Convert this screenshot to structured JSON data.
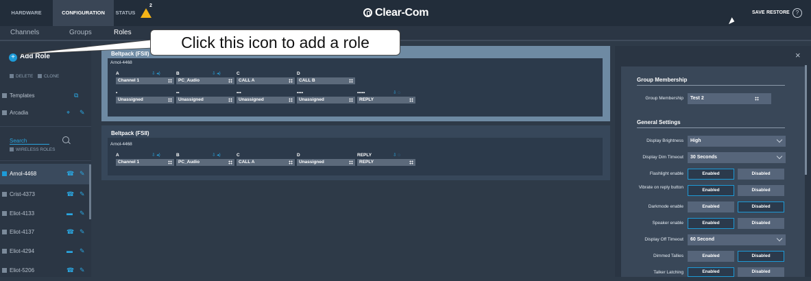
{
  "topbar": {
    "tabs": [
      "HARDWARE",
      "CONFIGURATION",
      "STATUS"
    ],
    "status_count": "2",
    "brand": "Clear-Com",
    "save_label": "SAVE",
    "restore_label": "RESTORE",
    "help_glyph": "?"
  },
  "subnav": {
    "tabs": [
      "Channels",
      "Groups",
      "Roles"
    ]
  },
  "callout": {
    "text": "Click this icon to add a role"
  },
  "sidebar": {
    "add_role": "Add Role",
    "delete": "DELETE",
    "clone": "CLONE",
    "templates": "Templates",
    "arcadia": "Arcadia",
    "search": "Search",
    "wireless_roles": "WIRELESS ROLES",
    "roles": [
      {
        "label": "Arnol-4468",
        "selected": true
      },
      {
        "label": "Crist-4373",
        "selected": false
      },
      {
        "label": "Eliot-4133",
        "selected": false
      },
      {
        "label": "Eliot-4137",
        "selected": false
      },
      {
        "label": "Eliot-4294",
        "selected": false
      },
      {
        "label": "Eliot-5206",
        "selected": false
      }
    ]
  },
  "beltpacks": [
    {
      "title": "Beltpack (FSII)",
      "owner": "Arnol-4468",
      "keys_row1": [
        {
          "key": "A",
          "value": "Channel 1"
        },
        {
          "key": "B",
          "value": "PC_Audio"
        },
        {
          "key": "C",
          "value": "CALL A"
        },
        {
          "key": "D",
          "value": "CALL B"
        }
      ],
      "keys_row2": [
        {
          "key": "•",
          "value": "Unassigned"
        },
        {
          "key": "••",
          "value": "Unassigned"
        },
        {
          "key": "•••",
          "value": "Unassigned"
        },
        {
          "key": "••••",
          "value": "Unassigned"
        },
        {
          "key": "•••••",
          "value": "REPLY"
        }
      ]
    },
    {
      "title": "Beltpack (FSII)",
      "owner": "Arnol-4468",
      "keys_row1": [
        {
          "key": "A",
          "value": "Channel 1"
        },
        {
          "key": "B",
          "value": "PC_Audio"
        },
        {
          "key": "C",
          "value": "CALL A"
        },
        {
          "key": "D",
          "value": "Unassigned"
        },
        {
          "key": "REPLY",
          "value": "REPLY"
        }
      ]
    }
  ],
  "panel": {
    "close": "×",
    "group_section": "Group Membership",
    "group_label": "Group Membership",
    "group_value": "Test 2",
    "general_section": "General Settings",
    "settings": [
      {
        "label": "Display Brightness",
        "type": "select",
        "value": "High"
      },
      {
        "label": "Display Dim Timeout",
        "type": "select",
        "value": "30 Seconds"
      },
      {
        "label": "Flashlight enable",
        "type": "toggle",
        "on": "Enabled",
        "off": "Disabled",
        "selected": "Enabled"
      },
      {
        "label": "Vibrate on reply button",
        "type": "toggle",
        "on": "Enabled",
        "off": "Disabled",
        "selected": "Enabled"
      },
      {
        "label": "Darkmode enable",
        "type": "toggle",
        "on": "Enabled",
        "off": "Disabled",
        "selected": "Disabled"
      },
      {
        "label": "Speaker enable",
        "type": "toggle",
        "on": "Enabled",
        "off": "Disabled",
        "selected": "Enabled"
      },
      {
        "label": "Display Off Timeout",
        "type": "select",
        "value": "60 Second"
      },
      {
        "label": "Dimmed Tallies",
        "type": "toggle",
        "on": "Enabled",
        "off": "Disabled",
        "selected": "Disabled"
      },
      {
        "label": "Talker Latching",
        "type": "toggle",
        "on": "Enabled",
        "off": "Disabled",
        "selected": "Enabled"
      }
    ]
  },
  "colors": {
    "accent": "#1d9bd8",
    "warning": "#f5b417",
    "background": "#2e3a48"
  }
}
